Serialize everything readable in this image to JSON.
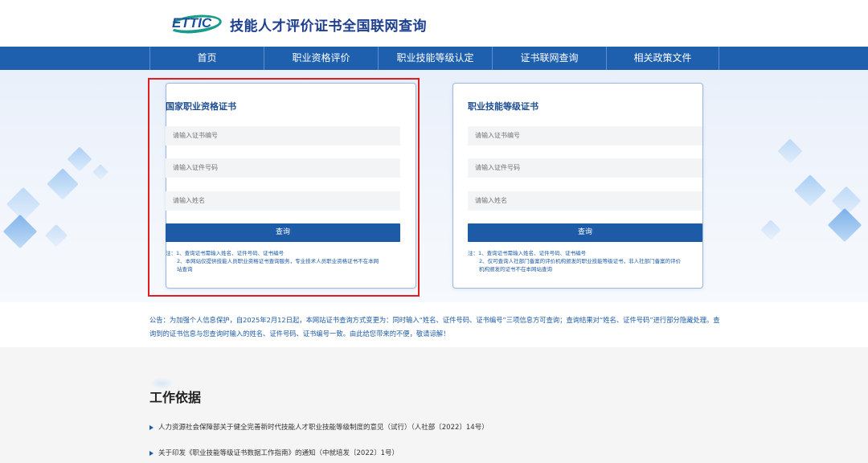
{
  "header": {
    "logo_text": "ETTIC",
    "site_title": "技能人才评价证书全国联网查询"
  },
  "nav": {
    "items": [
      {
        "label": "首页"
      },
      {
        "label": "职业资格评价"
      },
      {
        "label": "职业技能等级认定"
      },
      {
        "label": "证书联网查询"
      },
      {
        "label": "相关政策文件"
      }
    ]
  },
  "cards": {
    "left": {
      "title": "国家职业资格证书",
      "cert_no_placeholder": "请输入证书编号",
      "id_no_placeholder": "请输入证件号码",
      "name_placeholder": "请输入姓名",
      "button_label": "查询",
      "note1": "注：1、查询证书需输入姓名、证件号码、证书编号",
      "note2": "2、本网站仅提供技能人员职业资格证书查询服务，专业技术人员职业资格证书不在本网",
      "note3": "站查询"
    },
    "right": {
      "title": "职业技能等级证书",
      "cert_no_placeholder": "请输入证书编号",
      "id_no_placeholder": "请输入证件号码",
      "name_placeholder": "请输入姓名",
      "button_label": "查询",
      "note1": "注：1、查询证书需输入姓名、证件号码、证书编号",
      "note2": "2、仅可查询人社部门备案的评价机构颁发的职业技能等级证书，非人社部门备案的评价",
      "note3": "机构颁发的证书不在本网站查询"
    }
  },
  "announcement": {
    "text": "公告：为加强个人信息保护，自2025年2月12日起，本网站证书查询方式变更为：同时输入“姓名、证件号码、证书编号”三项信息方可查询；查询结果对“姓名、证件号码”进行部分隐藏处理。查询到的证书信息与您查询时输入的姓名、证件号码、证书编号一致。由此给您带来的不便，敬请谅解！"
  },
  "basis": {
    "title": "工作依据",
    "items": [
      {
        "text": "人力资源社会保障部关于健全完善新时代技能人才职业技能等级制度的意见（试行）（人社部〔2022〕14号）"
      },
      {
        "text": "关于印发《职业技能等级证书数据工作指南》的通知（中就培发〔2022〕1号）"
      }
    ]
  },
  "colors": {
    "nav_bg": "#1e5fae",
    "button_bg": "#1d5ba6",
    "highlight": "#e11d1d",
    "title_blue": "#1e4e92"
  }
}
